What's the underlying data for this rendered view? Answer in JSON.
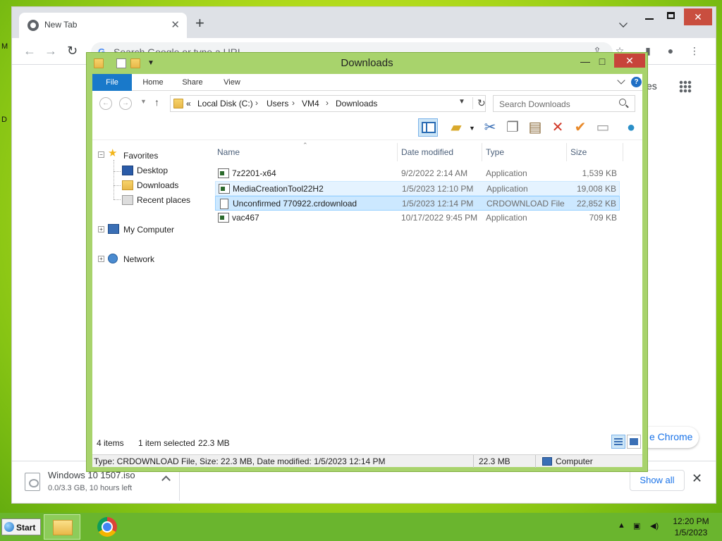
{
  "desktop": {
    "left_fragments": [
      "M",
      "D"
    ]
  },
  "chrome": {
    "tab_title": "New Tab",
    "tab_close": "✕",
    "new_tab": "+",
    "omnibox_placeholder": "Search Google or type a URL",
    "omnibox_g": "G",
    "partial_text_right": "es",
    "customize_text": "e Chrome",
    "download": {
      "name": "Windows 10 1507.iso",
      "status": "0.0/3.3 GB, 10 hours left"
    },
    "show_all": "Show all",
    "shelf_close": "✕"
  },
  "explorer": {
    "title": "Downloads",
    "close_glyph": "✕",
    "ribbon_tabs": [
      "File",
      "Home",
      "Share",
      "View"
    ],
    "help": "?",
    "breadcrumb": [
      "«",
      "Local Disk (C:)",
      "Users",
      "VM4",
      "Downloads"
    ],
    "search_placeholder": "Search Downloads",
    "nav_tree": {
      "favorites": "Favorites",
      "desktop": "Desktop",
      "downloads": "Downloads",
      "recent": "Recent places",
      "computer": "My Computer",
      "network": "Network"
    },
    "columns": {
      "name": "Name",
      "date": "Date modified",
      "type": "Type",
      "size": "Size"
    },
    "files": [
      {
        "name": "7z2201-x64",
        "date": "9/2/2022 2:14 AM",
        "type": "Application",
        "size": "1,539 KB",
        "icon": "app-icon",
        "state": "normal"
      },
      {
        "name": "MediaCreationTool22H2",
        "date": "1/5/2023 12:10 PM",
        "type": "Application",
        "size": "19,008 KB",
        "icon": "app-icon",
        "state": "hover"
      },
      {
        "name": "Unconfirmed 770922.crdownload",
        "date": "1/5/2023 12:14 PM",
        "type": "CRDOWNLOAD File",
        "size": "22,852 KB",
        "icon": "document-icon",
        "state": "selected"
      },
      {
        "name": "vac467",
        "date": "10/17/2022 9:45 PM",
        "type": "Application",
        "size": "709 KB",
        "icon": "app-icon",
        "state": "normal"
      }
    ],
    "status": {
      "count": "4 items",
      "selected": "1 item selected",
      "selected_size": "22.3 MB"
    },
    "statusbar": {
      "details": "Type: CRDOWNLOAD File, Size: 22.3 MB, Date modified: 1/5/2023 12:14 PM",
      "size": "22.3 MB",
      "location": "Computer"
    }
  },
  "taskbar": {
    "start_label": "Start",
    "clock_time": "12:20 PM",
    "clock_date": "1/5/2023"
  }
}
